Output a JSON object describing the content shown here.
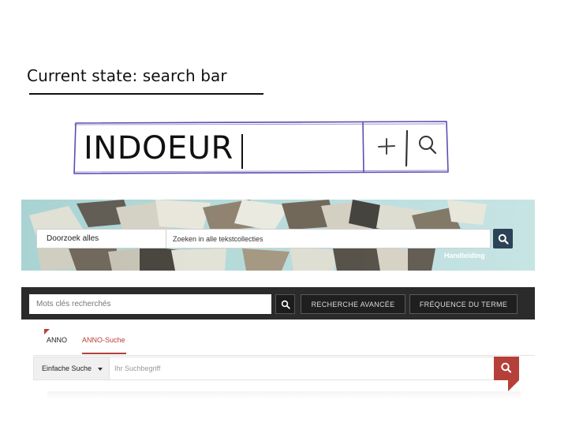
{
  "slide": {
    "title": "Current state: search bar"
  },
  "sketch": {
    "typed_text": "INDOEUR",
    "plus_symbol": "+"
  },
  "delpher": {
    "collection_select": "Doorzoek alles",
    "search_placeholder": "Zoeken in alle tekstcollecties",
    "help_link": "Handleiding",
    "icons": {
      "search": "search-icon",
      "chevron": "chevron-down-icon"
    },
    "colors": {
      "button": "#2b4257",
      "banner": "#bcdcdc"
    }
  },
  "gallica": {
    "search_placeholder": "Mots clés recherchés",
    "advanced_button": "RECHERCHE AVANCÉE",
    "frequency_button": "FRÉQUENCE DU TERME",
    "colors": {
      "bar": "#2b2b2b"
    }
  },
  "anno": {
    "tabs": [
      {
        "label": "ANNO",
        "active": false
      },
      {
        "label": "ANNO-Suche",
        "active": true
      }
    ],
    "mode_select": "Einfache Suche",
    "search_placeholder": "Ihr Suchbegriff",
    "colors": {
      "accent": "#b5403a"
    }
  }
}
